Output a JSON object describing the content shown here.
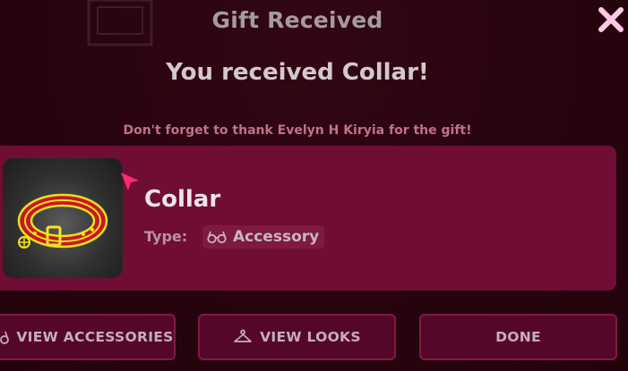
{
  "dialog": {
    "title": "Gift Received",
    "headline": "You received Collar!",
    "thank_note": "Don't forget to thank Evelyn H Kiryia for the gift!",
    "close_icon": "close-x-icon"
  },
  "item": {
    "name": "Collar",
    "type_label": "Type:",
    "type_value": "Accessory",
    "type_icon": "glasses-icon",
    "thumbnail_icon": "collar-icon"
  },
  "buttons": {
    "view_accessories": "VIEW ACCESSORIES",
    "view_looks": "VIEW LOOKS",
    "done": "DONE"
  },
  "colors": {
    "background": "#28040f",
    "card": "#6f0d35",
    "button": "#55072a",
    "button_border": "#7e1b45",
    "accent_pink": "#ff2a77",
    "note_text": "#c2708f",
    "close_icon": "#ffc8e4"
  }
}
